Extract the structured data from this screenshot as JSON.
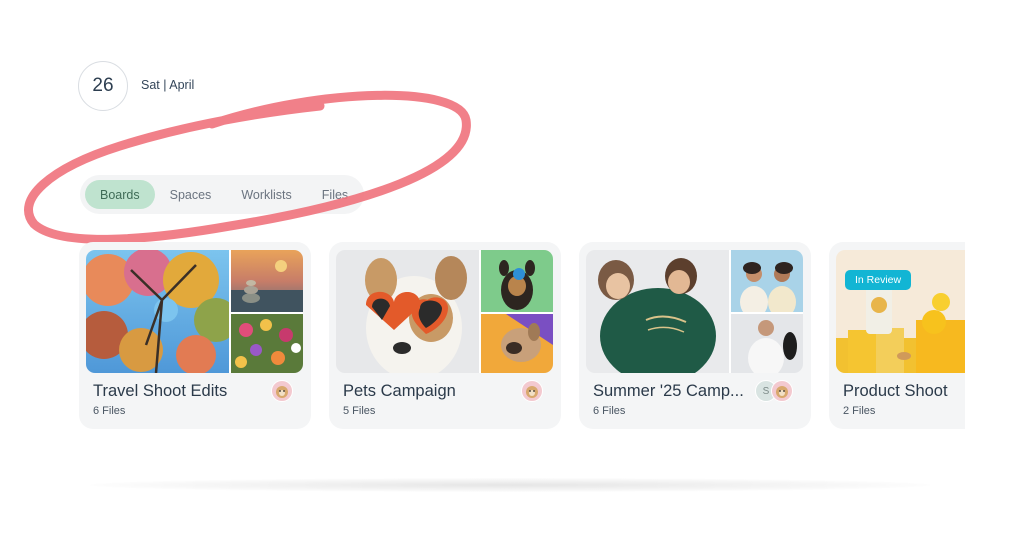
{
  "date": {
    "day": "26",
    "label": "Sat | April"
  },
  "tabs": [
    {
      "label": "Boards",
      "active": true
    },
    {
      "label": "Spaces",
      "active": false
    },
    {
      "label": "Worklists",
      "active": false
    },
    {
      "label": "Files",
      "active": false
    }
  ],
  "boards": [
    {
      "title": "Travel Shoot Edits",
      "count": "6 Files"
    },
    {
      "title": "Pets Campaign",
      "count": "5 Files"
    },
    {
      "title": "Summer '25 Camp...",
      "count": "6 Files",
      "avatar_letter": "S"
    },
    {
      "title": "Product Shoot",
      "count": "2 Files",
      "badge": "In Review"
    }
  ],
  "colors": {
    "active_tab": "#bfe3cf",
    "scribble": "#f0727c",
    "badge": "#12b5d4"
  }
}
